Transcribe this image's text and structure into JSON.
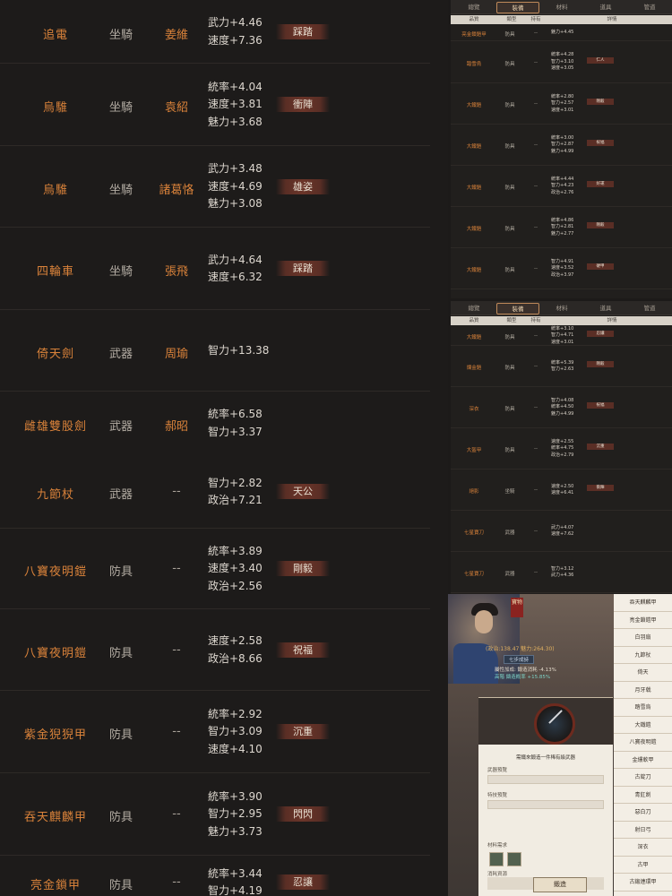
{
  "left_list": [
    {
      "name": "追電",
      "type": "坐騎",
      "owner": "姜維",
      "stats": [
        "武力+4.46",
        "速度+7.36"
      ],
      "tag": "踩踏"
    },
    {
      "name": "烏騅",
      "type": "坐騎",
      "owner": "袁紹",
      "stats": [
        "統率+4.04",
        "速度+3.81",
        "魅力+3.68"
      ],
      "tag": "衝陣"
    },
    {
      "name": "烏騅",
      "type": "坐騎",
      "owner": "諸葛恪",
      "stats": [
        "武力+3.48",
        "速度+4.69",
        "魅力+3.08"
      ],
      "tag": "雄姿"
    },
    {
      "name": "四輪車",
      "type": "坐騎",
      "owner": "張飛",
      "stats": [
        "武力+4.64",
        "速度+6.32"
      ],
      "tag": "踩踏"
    },
    {
      "name": "倚天劍",
      "type": "武器",
      "owner": "周瑜",
      "stats": [
        "智力+13.38"
      ],
      "tag": ""
    },
    {
      "name": "雌雄雙股劍",
      "type": "武器",
      "owner": "郝昭",
      "stats": [
        "統率+6.58",
        "智力+3.37"
      ],
      "tag": ""
    },
    {
      "name": "九節杖",
      "type": "武器",
      "owner": "--",
      "stats": [
        "智力+2.82",
        "政治+7.21"
      ],
      "tag": "天公"
    },
    {
      "name": "八寶夜明鎧",
      "type": "防具",
      "owner": "--",
      "stats": [
        "統率+3.89",
        "速度+3.40",
        "政治+2.56"
      ],
      "tag": "剛毅"
    },
    {
      "name": "八寶夜明鎧",
      "type": "防具",
      "owner": "--",
      "stats": [
        "速度+2.58",
        "政治+8.66"
      ],
      "tag": "祝福"
    },
    {
      "name": "紫金猊猊甲",
      "type": "防具",
      "owner": "--",
      "stats": [
        "統率+2.92",
        "智力+3.09",
        "速度+4.10"
      ],
      "tag": "沉重"
    },
    {
      "name": "吞天麒麟甲",
      "type": "防具",
      "owner": "--",
      "stats": [
        "統率+3.90",
        "智力+2.95",
        "魅力+3.73"
      ],
      "tag": "閃閃"
    },
    {
      "name": "亮金鎖甲",
      "type": "防具",
      "owner": "--",
      "stats": [
        "統率+3.44",
        "智力+4.19"
      ],
      "tag": "忍讓"
    }
  ],
  "panel_tabs": [
    "總覽",
    "裝備",
    "材料",
    "道具",
    "管道"
  ],
  "panel_headers": [
    "品質",
    "類型",
    "持有",
    "詳情"
  ],
  "panel1_rows": [
    {
      "name": "亮金鎖鎧甲",
      "type": "防具",
      "own": "--",
      "stats": [
        "魅力+4.45"
      ],
      "tag": ""
    },
    {
      "name": "踏雪烏",
      "type": "防具",
      "own": "--",
      "stats": [
        "統率+4.28",
        "智力+3.10",
        "速度+3.05"
      ],
      "tag": "仁人"
    },
    {
      "name": "大鐵鎧",
      "type": "防具",
      "own": "--",
      "stats": [
        "統率+2.80",
        "智力+2.57",
        "速度+3.01"
      ],
      "tag": "剛毅"
    },
    {
      "name": "大鐵鎧",
      "type": "防具",
      "own": "--",
      "stats": [
        "統率+3.00",
        "智力+2.87",
        "魅力+4.99"
      ],
      "tag": "祝福"
    },
    {
      "name": "大鐵鎧",
      "type": "防具",
      "own": "--",
      "stats": [
        "統率+4.44",
        "智力+4.23",
        "政治+2.76"
      ],
      "tag": "好運"
    },
    {
      "name": "大鐵鎧",
      "type": "防具",
      "own": "--",
      "stats": [
        "統率+4.86",
        "智力+2.81",
        "魅力+2.77"
      ],
      "tag": "剛毅"
    },
    {
      "name": "大鐵鎧",
      "type": "防具",
      "own": "--",
      "stats": [
        "智力+4.91",
        "速度+3.52",
        "政治+3.97"
      ],
      "tag": "硬甲"
    }
  ],
  "panel2_rows": [
    {
      "name": "大鐵鎧",
      "type": "防具",
      "own": "--",
      "stats": [
        "統率+3.10",
        "智力+4.71",
        "速度+3.01"
      ],
      "tag": "忍讓"
    },
    {
      "name": "爛金鎧",
      "type": "防具",
      "own": "--",
      "stats": [
        "統率+5.39",
        "智力+2.63"
      ],
      "tag": "剛毅"
    },
    {
      "name": "深衣",
      "type": "防具",
      "own": "--",
      "stats": [
        "智力+4.08",
        "統率+4.50",
        "魅力+4.99"
      ],
      "tag": "祝福"
    },
    {
      "name": "大盔甲",
      "type": "防具",
      "own": "--",
      "stats": [
        "速度+2.55",
        "統率+4.75",
        "政治+2.79"
      ],
      "tag": "沉重"
    },
    {
      "name": "絕影",
      "type": "坐騎",
      "own": "--",
      "stats": [
        "速度+2.50",
        "速度+6.41"
      ],
      "tag": "衝陣"
    },
    {
      "name": "七星寶刀",
      "type": "武器",
      "own": "--",
      "stats": [
        "武力+4.07",
        "速度+7.62"
      ],
      "tag": ""
    },
    {
      "name": "七星寶刀",
      "type": "武器",
      "own": "--",
      "stats": [
        "智力+3.12",
        "武力+4.36"
      ],
      "tag": ""
    }
  ],
  "game": {
    "seal": "寶物",
    "hero_stats": "(政治:138.47 魅力:264.30)",
    "chip": "七步成詩",
    "line1": "屬性加成: 鍛造消耗 -4.13%",
    "line2": "高階 鑄造概率 +15.85%",
    "dialog_title": "需鐵來鍛造一件稀有級武器",
    "sec1": "武器預覽",
    "sec2": "特技預覽",
    "sec3": "材料需求",
    "sec4": "消耗資源",
    "button": "鍛造",
    "list": [
      "吞天麒麟甲",
      "亮金鎖鎧甲",
      "白羽扇",
      "九節杖",
      "倚天",
      "月牙戟",
      "踏雪烏",
      "大鐵鎧",
      "八寶夜明鎧",
      "金縷軟甲",
      "古錠刀",
      "青釭劍",
      "惡白刀",
      "射日弓",
      "深衣",
      "古甲",
      "古鍛連環甲",
      "七寶刀"
    ]
  }
}
